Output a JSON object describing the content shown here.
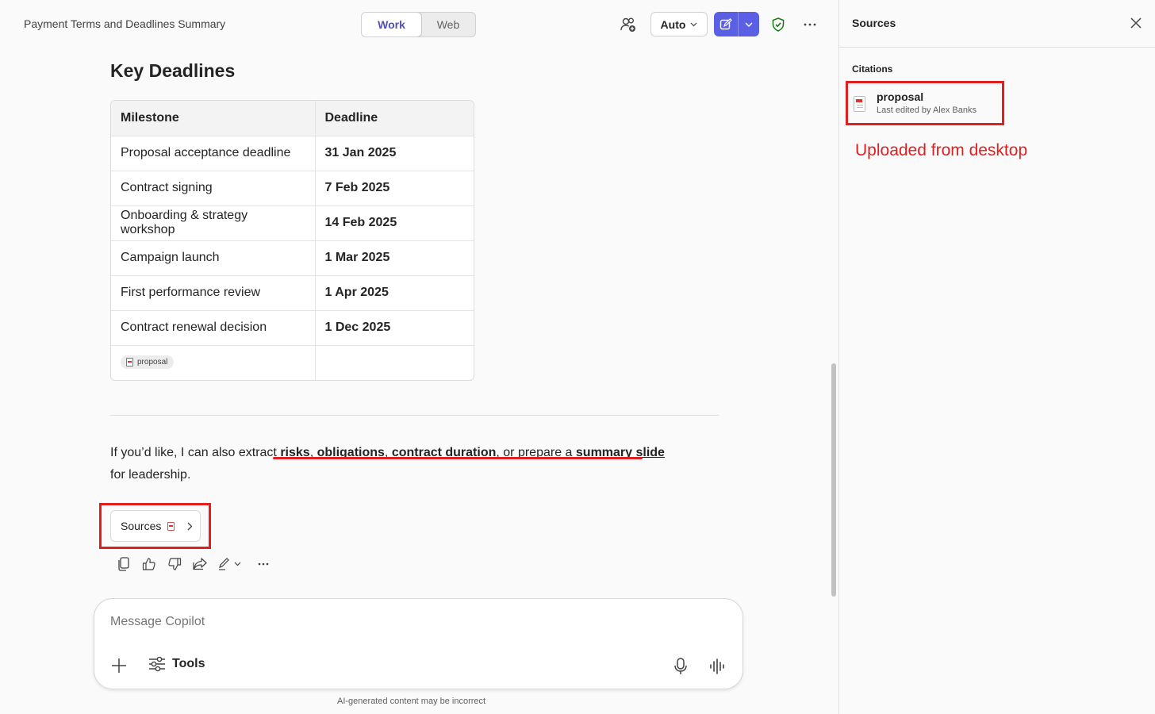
{
  "header": {
    "doc_title": "Payment Terms and Deadlines Summary",
    "modes": [
      "Work",
      "Web"
    ],
    "active_mode": "Work",
    "model_label": "Auto"
  },
  "main": {
    "heading": "Key Deadlines",
    "table": {
      "columns": [
        "Milestone",
        "Deadline"
      ],
      "rows": [
        [
          "Proposal acceptance deadline",
          "31 Jan 2025"
        ],
        [
          "Contract signing",
          "7 Feb 2025"
        ],
        [
          "Onboarding & strategy workshop",
          "14 Feb 2025"
        ],
        [
          "Campaign launch",
          "1 Mar 2025"
        ],
        [
          "First performance review",
          "1 Apr 2025"
        ],
        [
          "Contract renewal decision",
          "1 Dec 2025"
        ]
      ],
      "citation_chip": "proposal"
    },
    "followup": {
      "prefix": "If you’d like, I can also extract",
      "risks": "risks",
      "obligations": "obligations",
      "duration": "contract duration",
      "middle": ", or prepare a",
      "slide": "summary slide",
      "suffix": " for leadership."
    },
    "sources_label": "Sources"
  },
  "composer": {
    "placeholder": "Message Copilot",
    "tools_label": "Tools",
    "disclaimer": "AI-generated content may be incorrect"
  },
  "side_panel": {
    "title": "Sources",
    "section_label": "Citations",
    "citation": {
      "name": "proposal",
      "meta": "Last edited by Alex Banks"
    },
    "annotation": "Uploaded from desktop"
  },
  "colors": {
    "accent": "#5b5fe3",
    "annotation_red": "#e02020",
    "shield_green": "#107c10"
  }
}
